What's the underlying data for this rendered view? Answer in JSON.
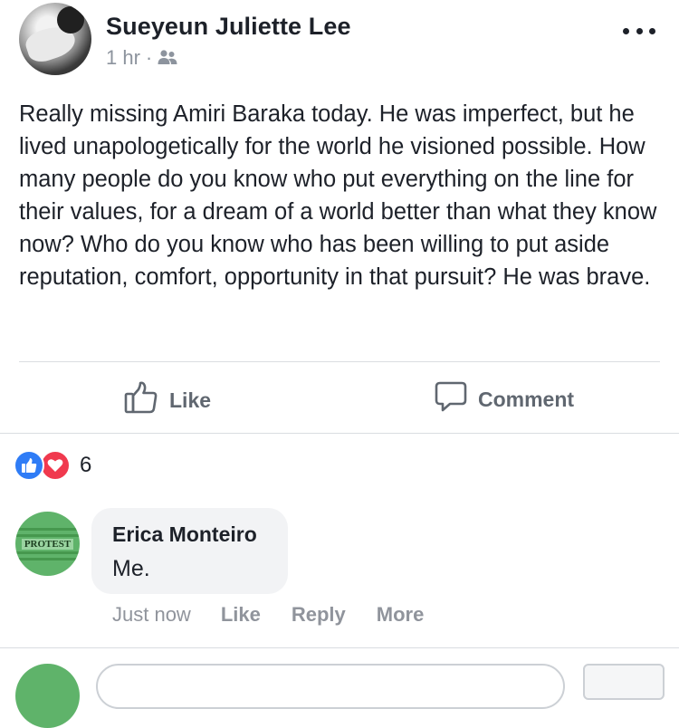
{
  "post": {
    "author": "Sueyeun Juliette Lee",
    "time": "1 hr",
    "separator": "·",
    "audience_icon": "friends-icon",
    "text": "Really missing Amiri Baraka today. He was imperfect, but he lived unapologetically for the world he visioned possible. How many people do you know who put everything on the line for their values, for a dream of a world better than what they know now? Who do you know who has been willing to put aside reputation, comfort, opportunity in that pursuit? He was brave."
  },
  "actions": {
    "like_label": "Like",
    "comment_label": "Comment"
  },
  "reactions": {
    "count": "6",
    "types": [
      "like-icon",
      "love-icon"
    ]
  },
  "comment": {
    "author": "Erica Monteiro",
    "text": "Me.",
    "avatar_text": "PROTEST",
    "time": "Just now",
    "like_label": "Like",
    "reply_label": "Reply",
    "more_label": "More"
  },
  "colors": {
    "accent_blue": "#2f7cf6",
    "love_red": "#f0394e",
    "muted_text": "#90949c"
  }
}
